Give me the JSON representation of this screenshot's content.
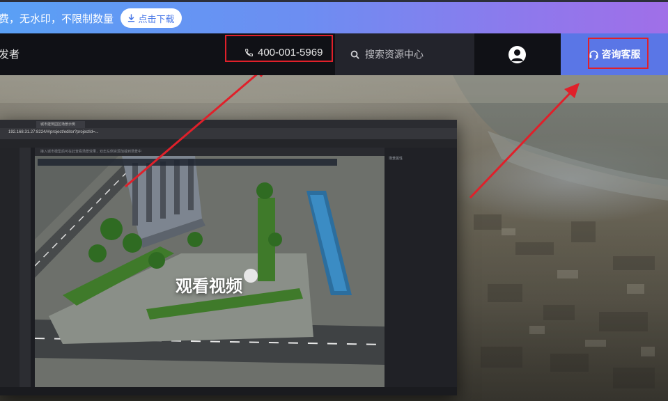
{
  "banner": {
    "text": "费，无水印，不限制数量",
    "download_label": "点击下载"
  },
  "nav": {
    "brand_text": "发者",
    "phone": "400-001-5969",
    "search_placeholder": "搜索资源中心",
    "consult_label": "咨询客服"
  },
  "hero": {
    "play_label": "观看视频",
    "app_screenshot": {
      "tab_title": "城市建筑园区场景示例",
      "address_url": "192.168.31.27:8224/#/project/editor?projectId=...",
      "notice_text": "接入城市模型后可在此查看场景效果，双击左侧资源加载到场景中",
      "panel_title": "场景属性"
    }
  },
  "colors": {
    "banner_gradient_start": "#5aa0f5",
    "banner_gradient_end": "#a06fe8",
    "nav_background": "#101116",
    "search_background": "#23242c",
    "consult_background": "#5a76e6",
    "highlight_red": "#e0202a"
  },
  "icons": {
    "download": "download-icon",
    "phone": "phone-icon",
    "search": "search-icon",
    "user": "user-avatar-icon",
    "headset": "headset-icon"
  }
}
